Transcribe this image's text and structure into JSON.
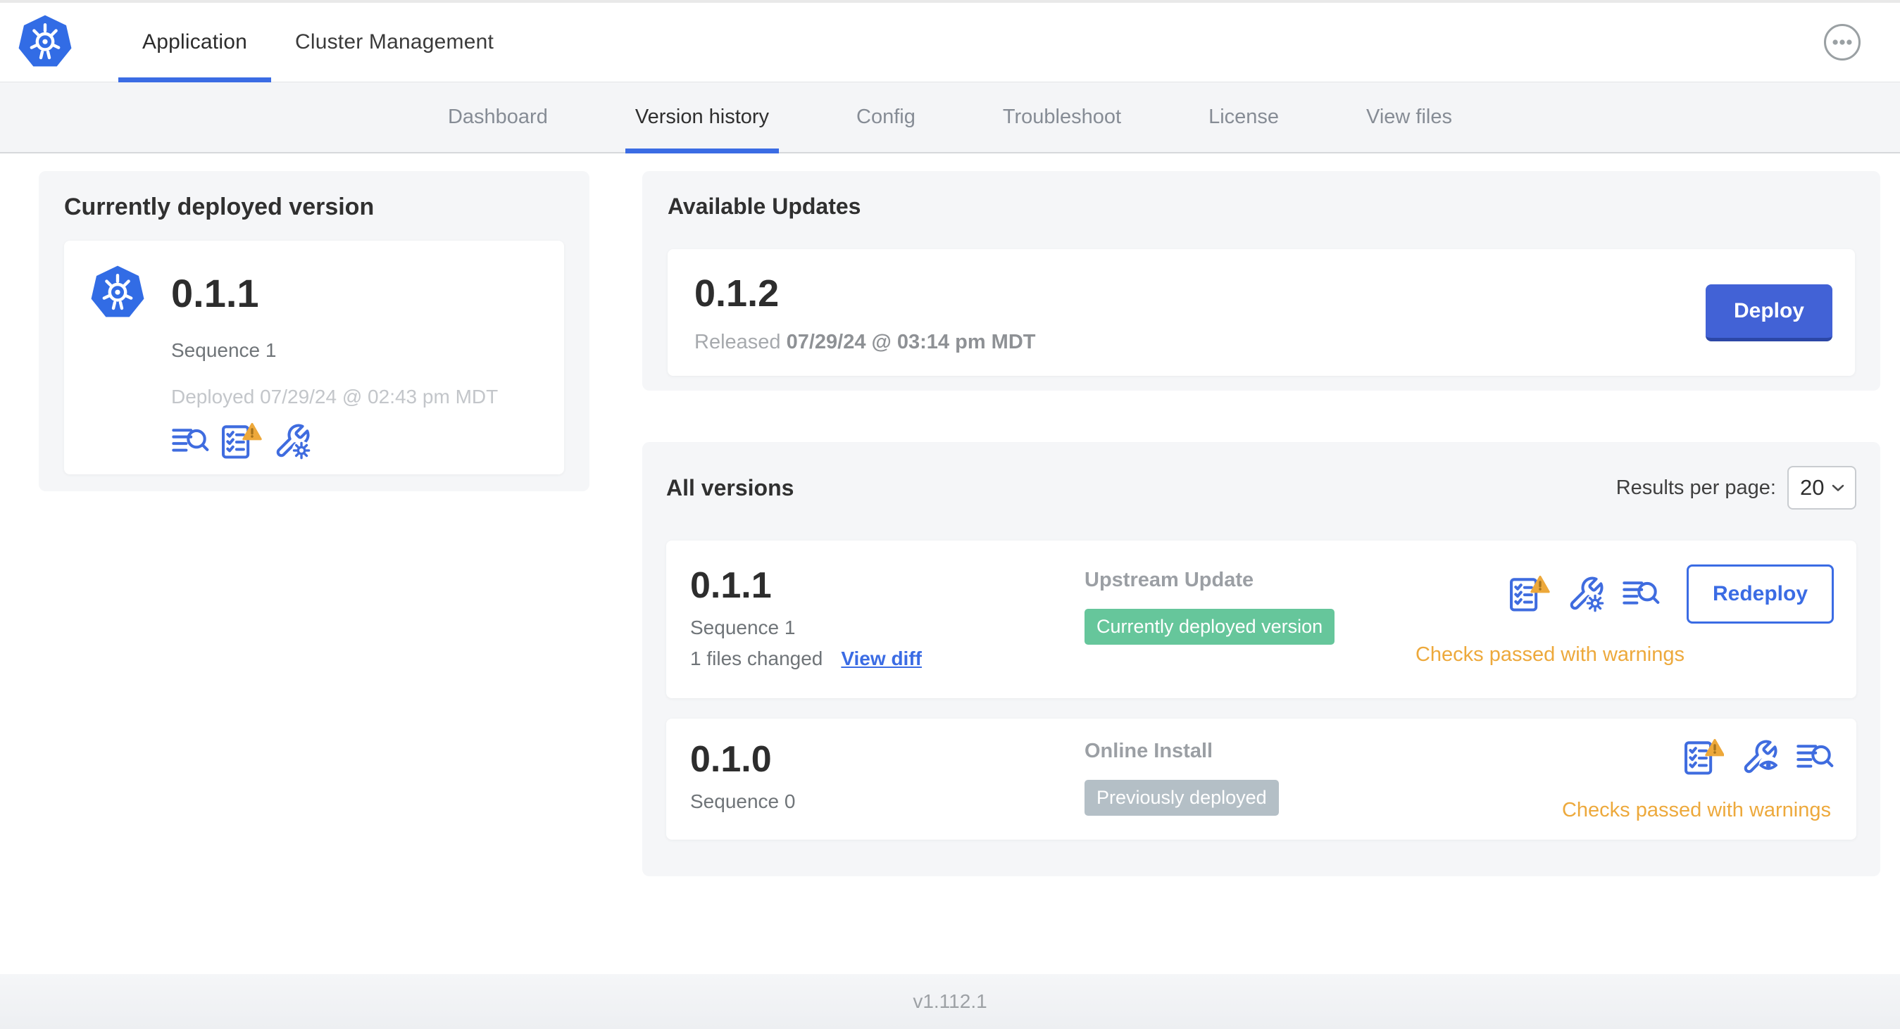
{
  "topbar": {
    "tabs": [
      {
        "label": "Application",
        "active": true
      },
      {
        "label": "Cluster Management",
        "active": false
      }
    ]
  },
  "subnav": {
    "tabs": [
      {
        "label": "Dashboard",
        "active": false
      },
      {
        "label": "Version history",
        "active": true
      },
      {
        "label": "Config",
        "active": false
      },
      {
        "label": "Troubleshoot",
        "active": false
      },
      {
        "label": "License",
        "active": false
      },
      {
        "label": "View files",
        "active": false
      }
    ]
  },
  "current_version": {
    "title": "Currently deployed version",
    "version": "0.1.1",
    "sequence": "Sequence 1",
    "deployed": "Deployed 07/29/24 @ 02:43 pm MDT"
  },
  "available_updates": {
    "title": "Available Updates",
    "version": "0.1.2",
    "released_label": "Released",
    "released_date": "07/29/24 @ 03:14 pm MDT",
    "deploy_label": "Deploy"
  },
  "all_versions": {
    "title": "All versions",
    "results_per_page_label": "Results per page:",
    "results_per_page_value": "20",
    "rows": [
      {
        "version": "0.1.1",
        "sequence": "Sequence 1",
        "files_changed": "1 files changed",
        "view_diff_label": "View diff",
        "source": "Upstream Update",
        "badge": "Currently deployed version",
        "badge_style": "green",
        "status": "Checks passed with warnings",
        "action_label": "Redeploy"
      },
      {
        "version": "0.1.0",
        "sequence": "Sequence 0",
        "source": "Online Install",
        "badge": "Previously deployed",
        "badge_style": "gray",
        "status": "Checks passed with warnings"
      }
    ]
  },
  "footer": {
    "version": "v1.112.1"
  },
  "icons": {
    "topbar": [
      "kubernetes-logo",
      "dots-menu-icon"
    ],
    "version_actions": [
      "file-logs-icon",
      "checklist-warning-icon",
      "wrench-gear-icon",
      "wrench-eye-icon"
    ],
    "select": [
      "chevron-down-icon"
    ]
  },
  "colors": {
    "kubernetes_blue": "#326ce5",
    "accent_blue": "#3b6ce4",
    "button_blue": "#4262d6",
    "warning_orange": "#eda93c",
    "badge_green": "#66c69b",
    "badge_gray": "#b4bfc6",
    "subnav_bg": "#f4f5f7",
    "card_bg": "#f5f6f8"
  }
}
